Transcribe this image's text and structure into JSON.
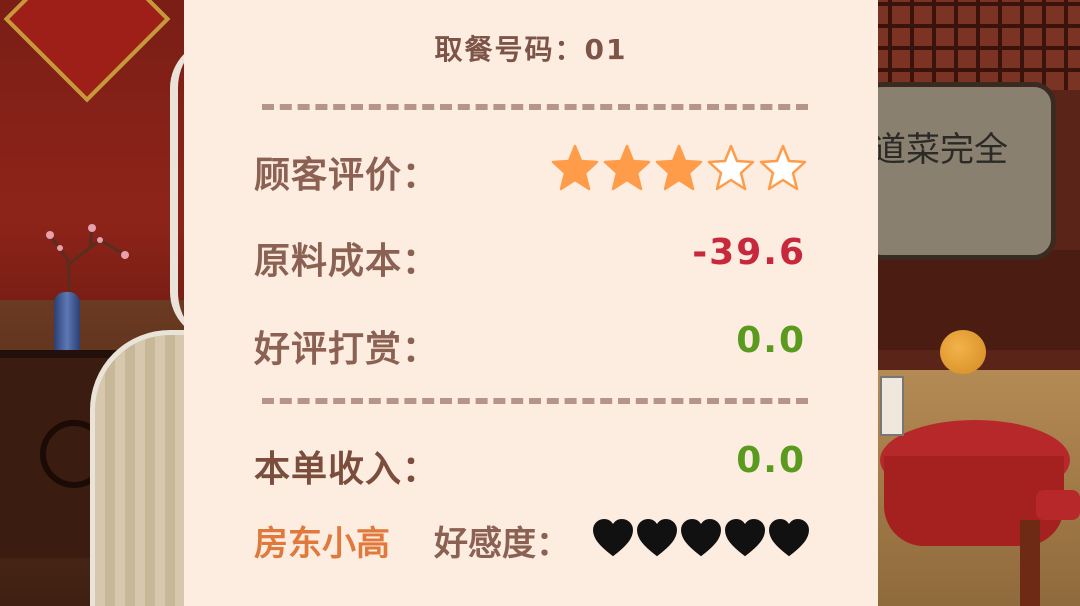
{
  "receipt": {
    "order_number_label": "取餐号码：01",
    "customer_rating_label": "顾客评价：",
    "rating": {
      "filled": 3,
      "total": 5
    },
    "ingredient_cost_label": "原料成本：",
    "ingredient_cost_value": "-39.6",
    "tip_label": "好评打赏：",
    "tip_value": "0.0",
    "order_income_label": "本单收入：",
    "order_income_value": "0.0",
    "landlord_name": "房东小高",
    "favorability_label": "好感度：",
    "favorability": {
      "filled": 5,
      "total": 5
    }
  },
  "speech_bubble": {
    "text": "道菜完全"
  },
  "colors": {
    "panel_bg": "#fdece0",
    "label": "#8a6152",
    "negative": "#c8283c",
    "positive": "#5a9a1e",
    "landlord_name": "#e07a3c",
    "star_fill": "#ff9c4a",
    "heart": "#111111"
  }
}
